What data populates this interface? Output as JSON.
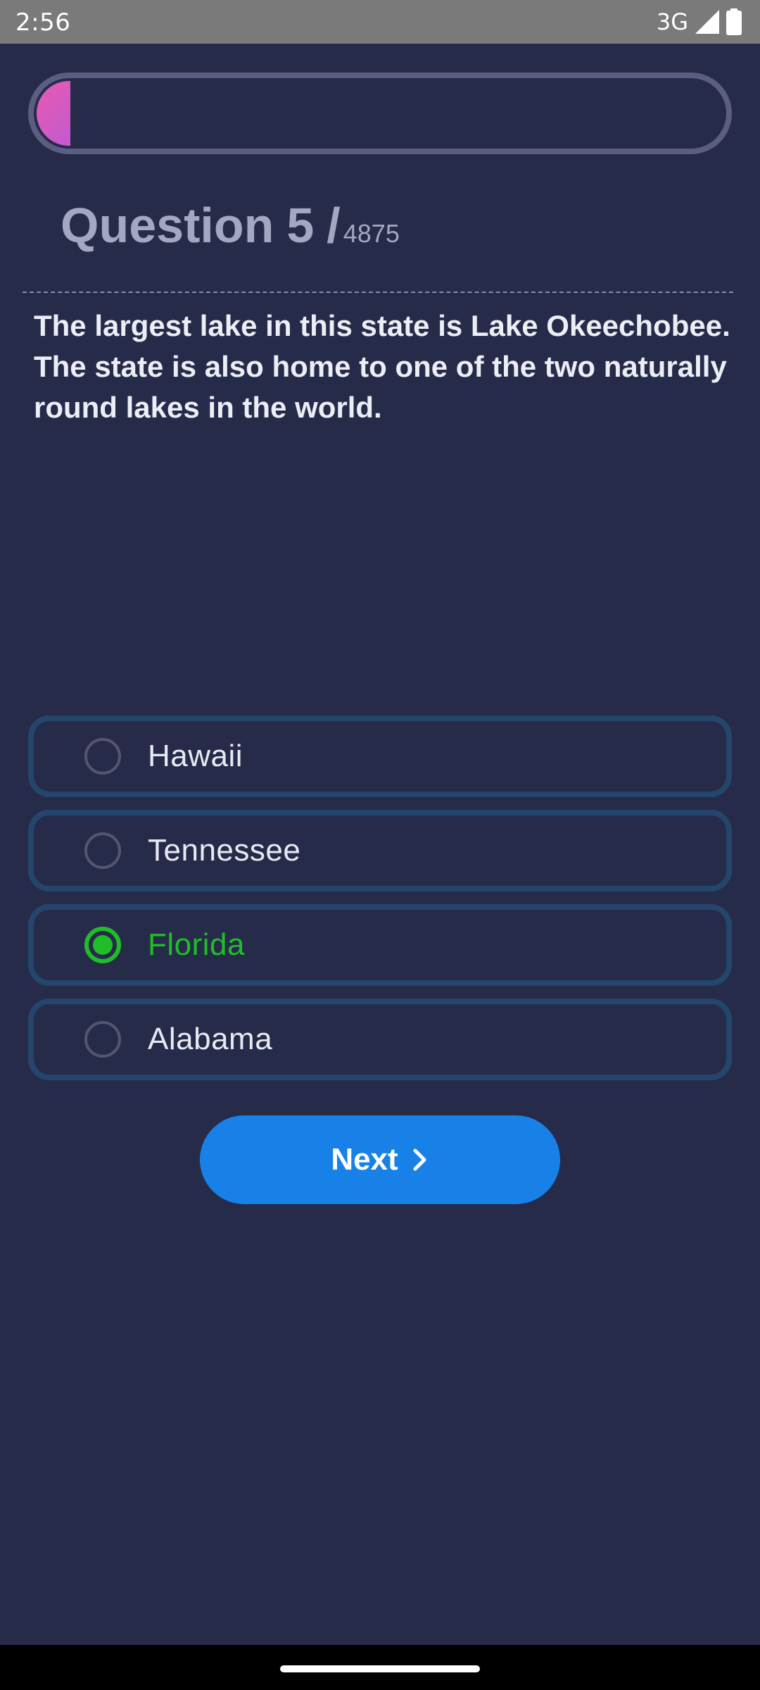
{
  "status_bar": {
    "time": "2:56",
    "network": "3G",
    "icons": [
      "signal-icon",
      "battery-icon"
    ]
  },
  "quiz": {
    "progress": 0.0041,
    "progress_colors": [
      "#e85ab0",
      "#c25ad0"
    ],
    "question_prefix": "Question",
    "question_number": "5",
    "question_slash": "/",
    "question_total": "4875",
    "question_text": "The largest lake in this state is Lake Okeechobee. The state is also home to one of the two naturally round lakes in the world.",
    "options": [
      {
        "label": "Hawaii",
        "selected": false
      },
      {
        "label": "Tennessee",
        "selected": false
      },
      {
        "label": "Florida",
        "selected": true
      },
      {
        "label": "Alabama",
        "selected": false
      }
    ],
    "next_label": "Next",
    "next_icon": "chevron-right-icon"
  },
  "colors": {
    "background": "#272b4a",
    "option_border": "#24456c",
    "selected": "#1fbe28",
    "button": "#1781e8",
    "header_text": "#a4a7c2"
  }
}
